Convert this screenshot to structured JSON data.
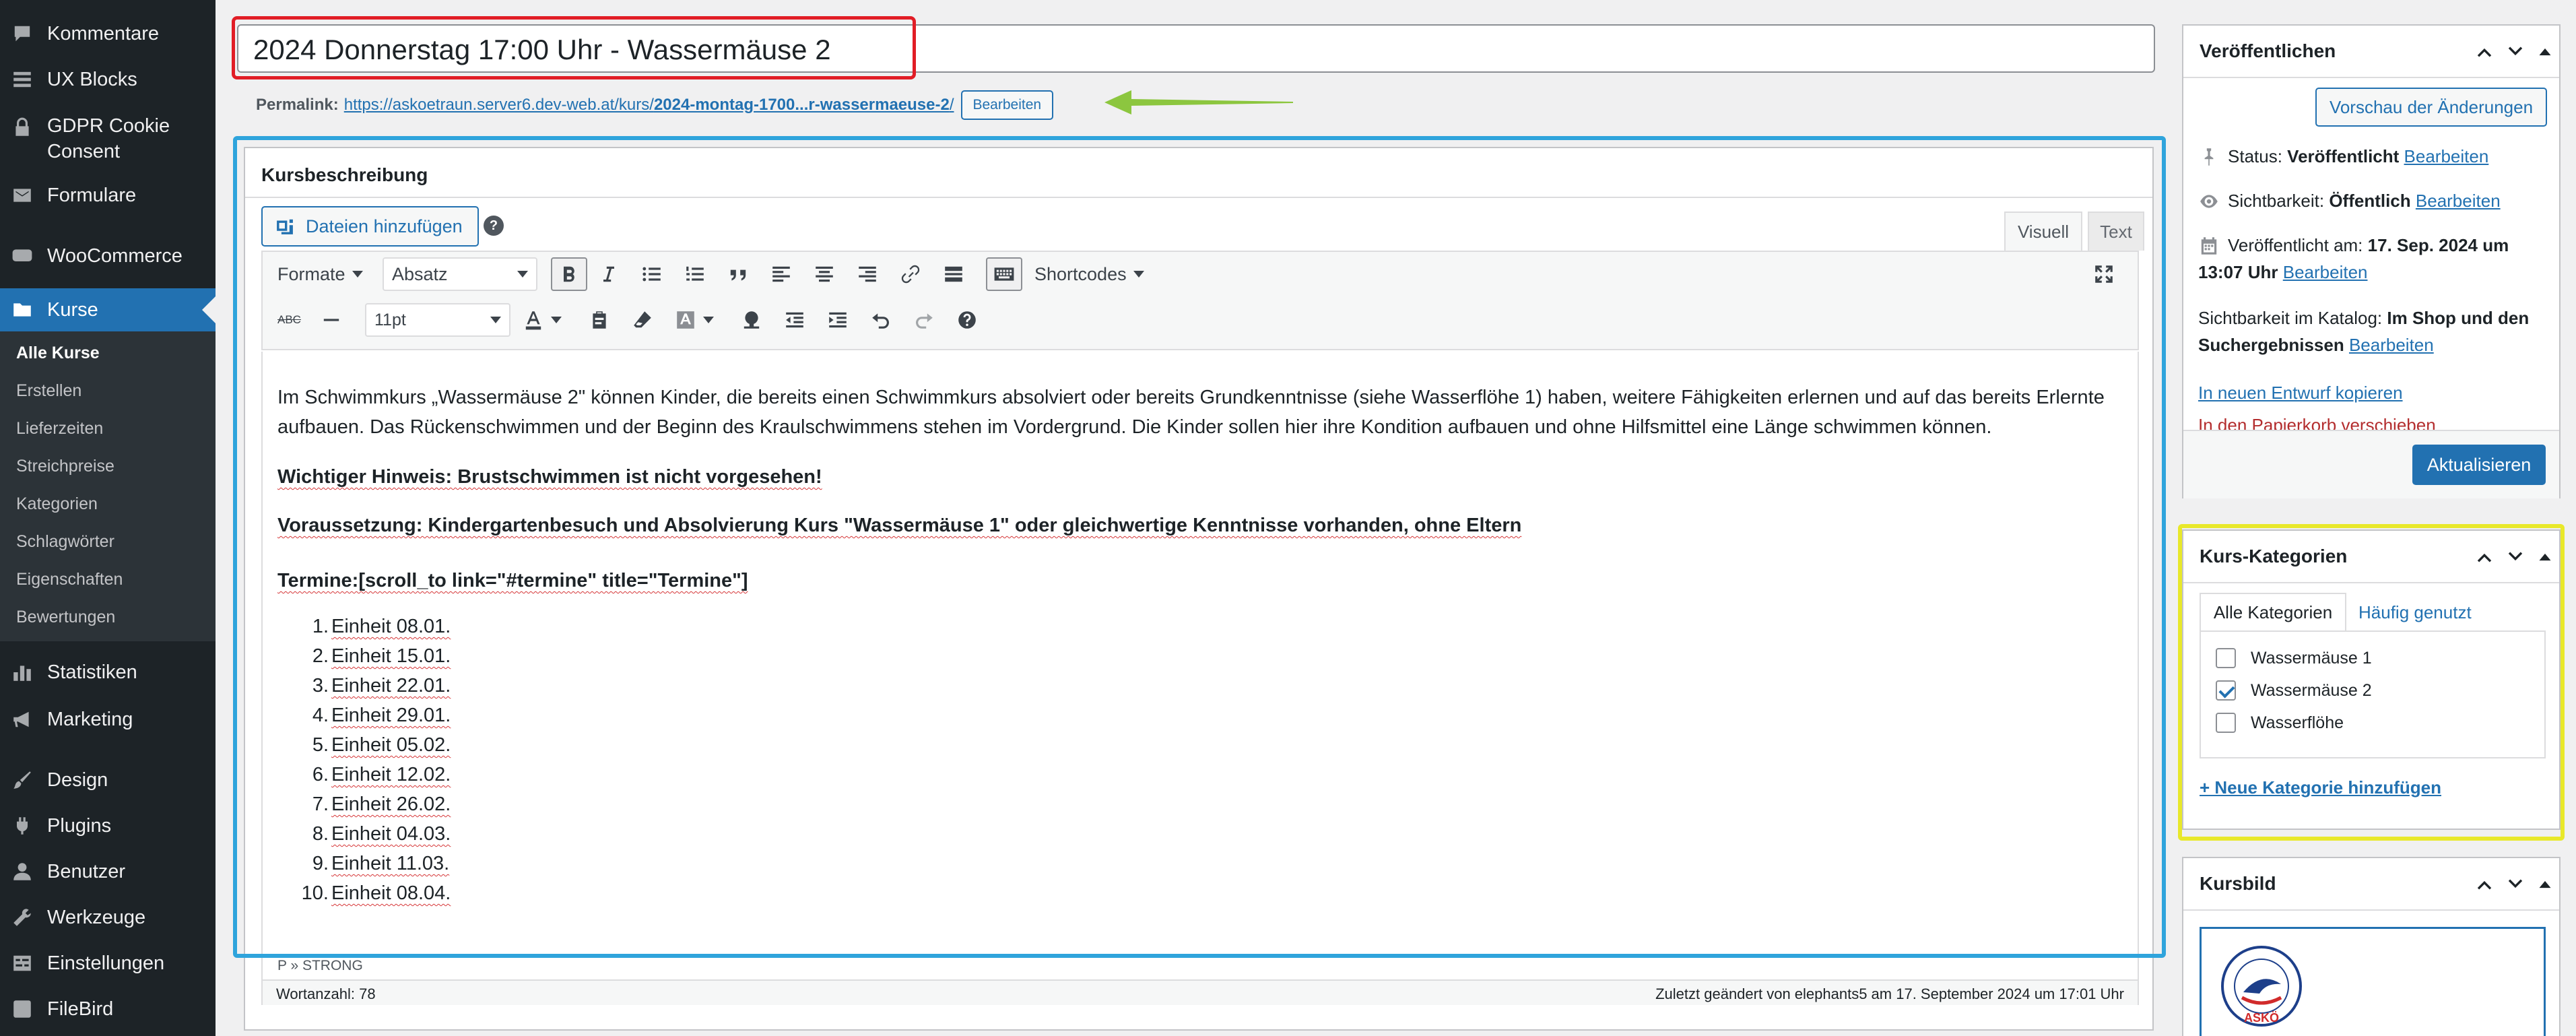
{
  "sidebar": {
    "items": [
      {
        "label": "Kommentare",
        "icon": "comment-icon"
      },
      {
        "label": "UX Blocks",
        "icon": "blocks-icon"
      },
      {
        "label": "GDPR Cookie Consent",
        "icon": "lock-icon"
      },
      {
        "label": "Formulare",
        "icon": "mail-icon"
      },
      {
        "label": "WooCommerce",
        "icon": "woocommerce-icon"
      },
      {
        "label": "Kurse",
        "icon": "folder-icon",
        "current": true
      },
      {
        "label": "Statistiken",
        "icon": "bar-chart-icon"
      },
      {
        "label": "Marketing",
        "icon": "megaphone-icon"
      },
      {
        "label": "Design",
        "icon": "brush-icon"
      },
      {
        "label": "Plugins",
        "icon": "plug-icon"
      },
      {
        "label": "Benutzer",
        "icon": "user-icon"
      },
      {
        "label": "Werkzeuge",
        "icon": "wrench-icon"
      },
      {
        "label": "Einstellungen",
        "icon": "settings-icon"
      },
      {
        "label": "FileBird",
        "icon": "filebird-icon"
      }
    ],
    "submenu": [
      "Alle Kurse",
      "Erstellen",
      "Lieferzeiten",
      "Streichpreise",
      "Kategorien",
      "Schlagwörter",
      "Eigenschaften",
      "Bewertungen"
    ]
  },
  "post": {
    "title": "2024 Donnerstag 17:00 Uhr - Wassermäuse 2",
    "permalink_label": "Permalink:",
    "permalink_base": "https://askoetraun.server6.dev-web.at/kurs/",
    "permalink_slug": "2024-montag-1700...r-wassermaeuse-2",
    "permalink_trail": "/",
    "permalink_edit": "Bearbeiten"
  },
  "editor": {
    "heading": "Kursbeschreibung",
    "add_media": "Dateien hinzufügen",
    "help": "?",
    "tab_visual": "Visuell",
    "tab_text": "Text",
    "format_label": "Formate",
    "block_select": "Absatz",
    "shortcodes_label": "Shortcodes",
    "font_size": "11pt",
    "para1": "Im Schwimmkurs „Wassermäuse 2\" können Kinder, die bereits einen Schwimmkurs absolviert oder bereits Grundkenntnisse (siehe Wasserflöhe 1) haben, weitere Fähigkeiten erlernen und auf das bereits Erlernte aufbauen. Das Rückenschwimmen und der Beginn des Kraulschwimmens stehen im Vordergrund. Die Kinder sollen hier ihre Kondition aufbauen und ohne Hilfsmittel eine Länge schwimmen können.",
    "para2": "Wichtiger Hinweis: Brustschwimmen ist nicht vorgesehen!",
    "para3": "Voraussetzung: Kindergartenbesuch und Absolvierung Kurs \"Wassermäuse 1\" oder gleichwertige Kenntnisse vorhanden, ohne Eltern",
    "para4": "Termine:[scroll_to link=\"#termine\" title=\"Termine\"]",
    "list": [
      "Einheit 08.01.",
      "Einheit 15.01.",
      "Einheit 22.01.",
      "Einheit 29.01.",
      "Einheit 05.02.",
      "Einheit 12.02.",
      "Einheit 26.02.",
      "Einheit 04.03.",
      "Einheit 11.03.",
      "Einheit 08.04."
    ],
    "path": "P » STRONG",
    "wordcount": "Wortanzahl: 78",
    "last_edit": "Zuletzt geändert von elephants5 am 17. September 2024 um 17:01 Uhr"
  },
  "publish": {
    "title": "Veröffentlichen",
    "preview": "Vorschau der Änderungen",
    "status_label": "Status:",
    "status_value": "Veröffentlicht",
    "visibility_label": "Sichtbarkeit:",
    "visibility_value": "Öffentlich",
    "published_label": "Veröffentlicht am:",
    "published_value": "17. Sep. 2024 um 13:07 Uhr",
    "catalog_label": "Sichtbarkeit im Katalog:",
    "catalog_value": "Im Shop und den Suchergebnissen",
    "edit": "Bearbeiten",
    "copy_draft": "In neuen Entwurf kopieren",
    "trash": "In den Papierkorb verschieben",
    "update": "Aktualisieren"
  },
  "categories": {
    "title": "Kurs-Kategorien",
    "tab_all": "Alle Kategorien",
    "tab_popular": "Häufig genutzt",
    "items": [
      {
        "label": "Wassermäuse 1",
        "checked": false
      },
      {
        "label": "Wassermäuse 2",
        "checked": true
      },
      {
        "label": "Wasserflöhe",
        "checked": false
      }
    ],
    "add": "+ Neue Kategorie hinzufügen"
  },
  "course_image": {
    "title": "Kursbild",
    "logo_text": "ASKÖ"
  },
  "colors": {
    "sidebar_bg": "#1d2327",
    "accent": "#2271b1",
    "highlight_red": "#e11d26",
    "highlight_blue": "#2fa4dc",
    "highlight_yellow": "#e8e82a",
    "arrow_green": "#8cc63f"
  }
}
